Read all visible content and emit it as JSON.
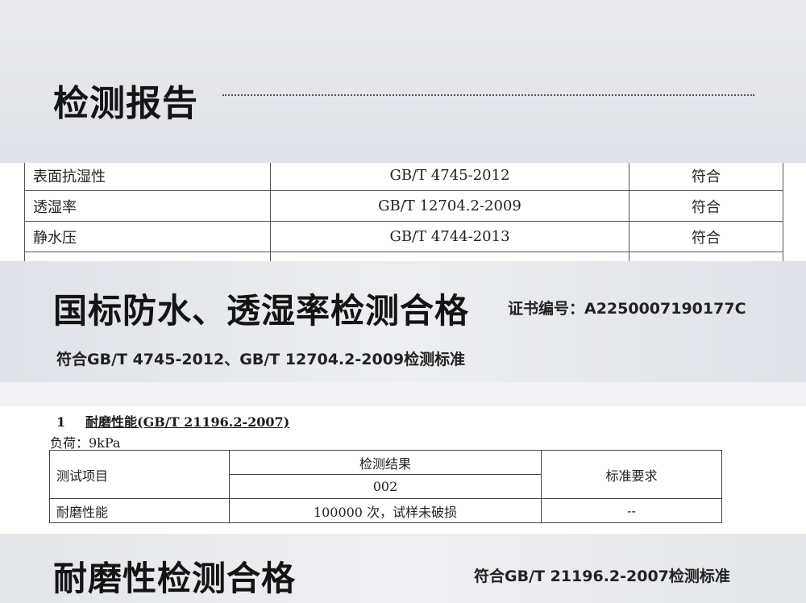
{
  "section1": {
    "title": "检测报告"
  },
  "table1": {
    "rows": [
      {
        "item": "表面抗湿性",
        "standard": "GB/T 4745-2012",
        "result": "符合"
      },
      {
        "item": "透湿率",
        "standard": "GB/T 12704.2-2009",
        "result": "符合"
      },
      {
        "item": "静水压",
        "standard": "GB/T 4744-2013",
        "result": "符合"
      }
    ]
  },
  "section2": {
    "title": "国标防水、透湿率检测合格",
    "certificate": "证书编号：A2250007190177C",
    "standards": "符合GB/T 4745-2012、GB/T 12704.2-2009检测标准"
  },
  "report2": {
    "section_number": "1",
    "section_title": "耐磨性能(GB/T 21196.2-2007)",
    "load": "负荷：9kPa",
    "header_item": "测试项目",
    "header_result": "检测结果",
    "header_sample": "002",
    "header_requirement": "标准要求",
    "row_item": "耐磨性能",
    "row_result": "100000 次，试样未破损",
    "row_requirement": "--"
  },
  "section3": {
    "title": "耐磨性检测合格",
    "standards": "符合GB/T 21196.2-2007检测标准"
  }
}
